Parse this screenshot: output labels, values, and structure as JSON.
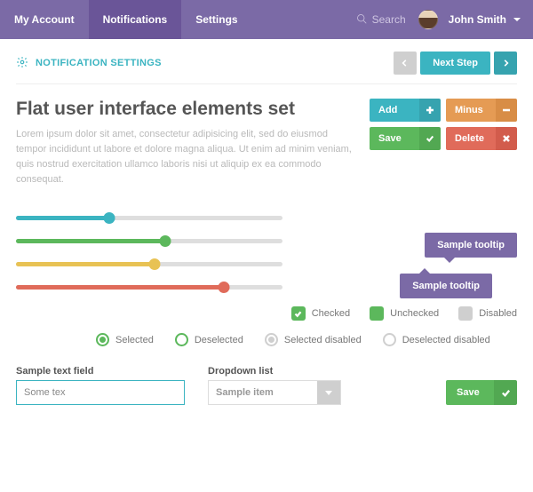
{
  "nav": {
    "items": [
      "My Account",
      "Notifications",
      "Settings"
    ],
    "active_index": 1,
    "search_label": "Search",
    "user_name": "John Smith"
  },
  "subhead": {
    "title": "NOTIFICATION SETTINGS",
    "next_label": "Next Step"
  },
  "content": {
    "heading": "Flat user interface elements set",
    "lorem": "Lorem ipsum dolor sit amet, consectetur adipisicing elit, sed do eiusmod tempor incididunt ut labore et dolore magna aliqua. Ut enim ad minim veniam, quis nostrud exercitation ullamco laboris nisi ut aliquip ex ea commodo consequat."
  },
  "actions": {
    "add": "Add",
    "minus": "Minus",
    "save": "Save",
    "delete": "Delete"
  },
  "sliders": [
    {
      "color": "teal",
      "percent": 35
    },
    {
      "color": "green",
      "percent": 56
    },
    {
      "color": "yellow",
      "percent": 52
    },
    {
      "color": "red",
      "percent": 78
    }
  ],
  "tooltips": {
    "t1": "Sample tooltip",
    "t2": "Sample tooltip"
  },
  "checks": {
    "checked": "Checked",
    "unchecked": "Unchecked",
    "disabled": "Disabled"
  },
  "radios": {
    "selected": "Selected",
    "deselected": "Deselected",
    "selected_disabled": "Selected disabled",
    "deselected_disabled": "Deselected disabled"
  },
  "form": {
    "text_label": "Sample text field",
    "text_value": "Some tex",
    "dropdown_label": "Dropdown list",
    "dropdown_value": "Sample item",
    "save": "Save"
  },
  "colors": {
    "purple": "#7b6aa6",
    "teal": "#3bb4c1",
    "green": "#5cb85c",
    "orange": "#e59b54",
    "red": "#e06b5a",
    "yellow": "#e8c254"
  }
}
